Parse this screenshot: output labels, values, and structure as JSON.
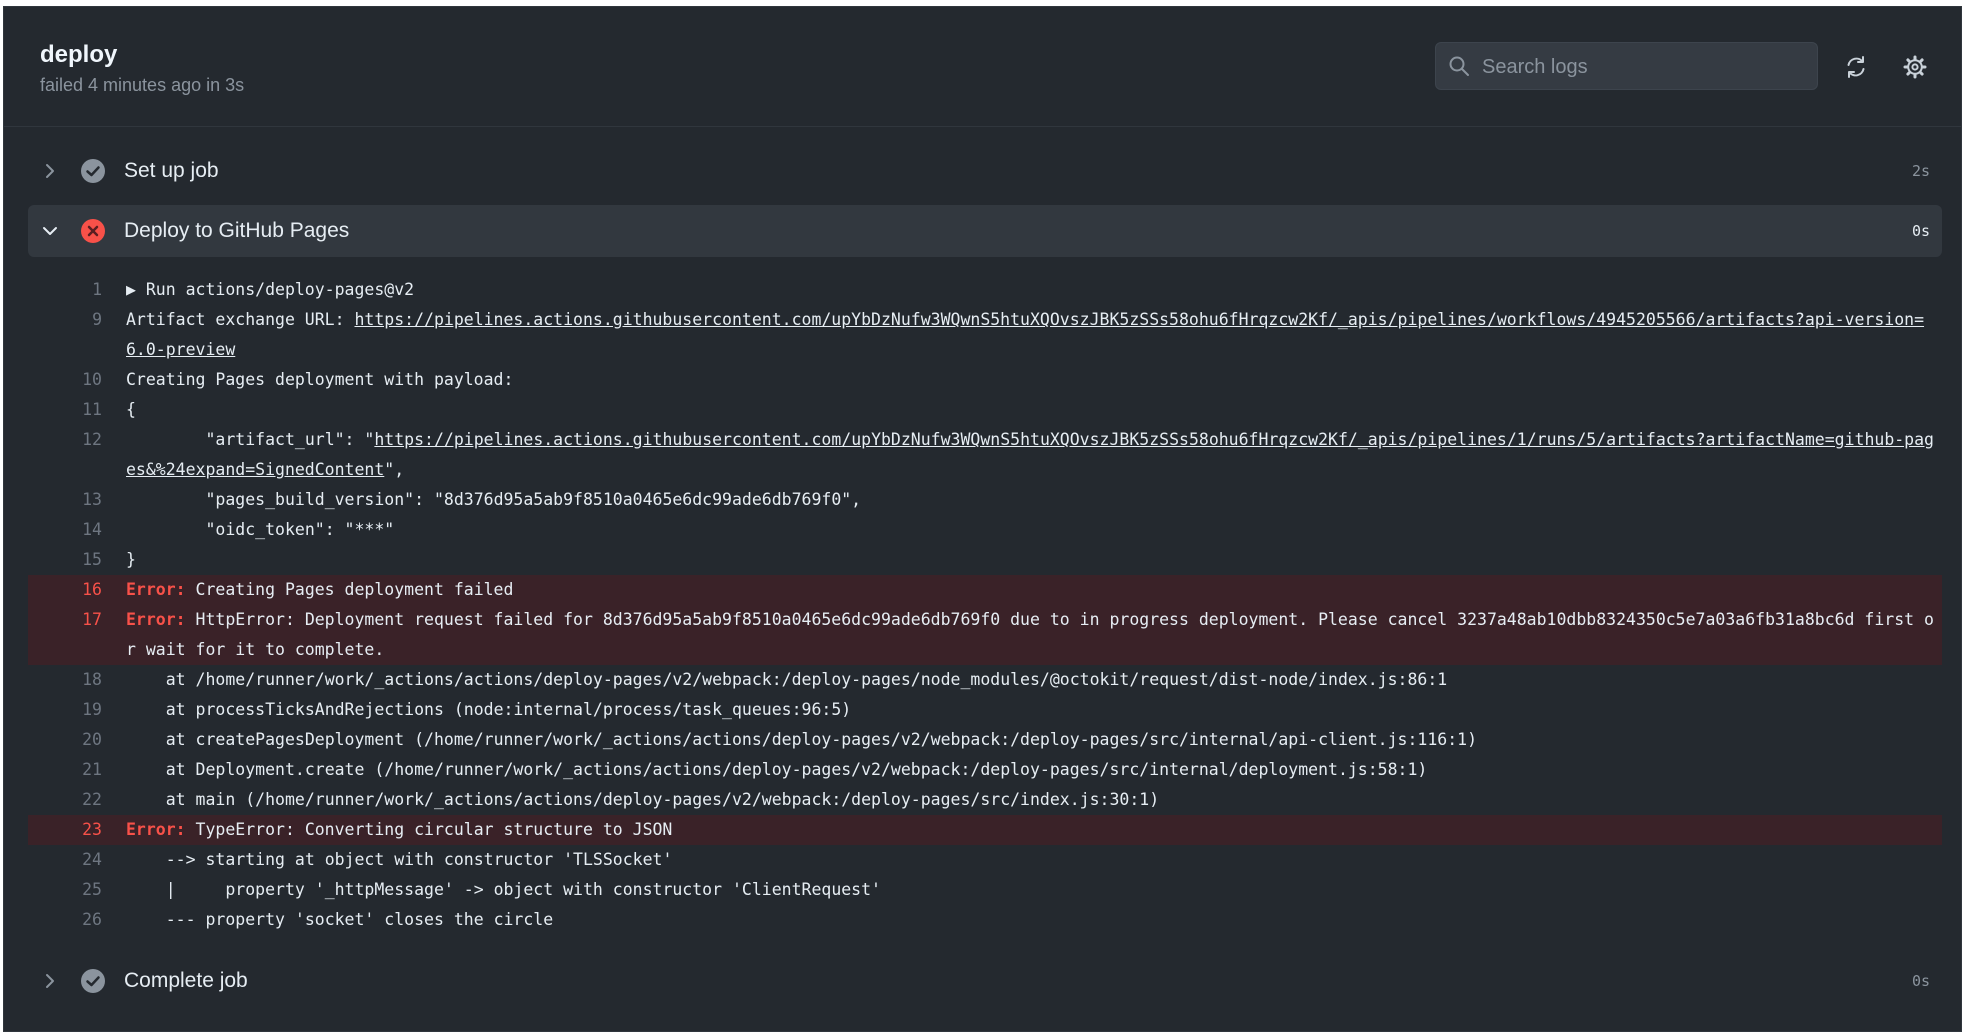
{
  "job": {
    "title": "deploy",
    "subtitle": "failed 4 minutes ago in 3s"
  },
  "search": {
    "placeholder": "Search logs"
  },
  "steps": [
    {
      "name": "Set up job",
      "duration": "2s",
      "status": "success"
    },
    {
      "name": "Deploy to GitHub Pages",
      "duration": "0s",
      "status": "failure"
    },
    {
      "name": "Complete job",
      "duration": "0s",
      "status": "success"
    }
  ],
  "log": {
    "l1": {
      "num": "1",
      "text": "▶ Run actions/deploy-pages@v2"
    },
    "l9": {
      "num": "9",
      "prefix": "Artifact exchange URL: ",
      "link": "https://pipelines.actions.githubusercontent.com/upYbDzNufw3WQwnS5htuXQOvszJBK5zSSs58ohu6fHrqzcw2Kf/_apis/pipelines/workflows/4945205566/artifacts?api-version=6.0-preview"
    },
    "l10": {
      "num": "10",
      "text": "Creating Pages deployment with payload:"
    },
    "l11": {
      "num": "11",
      "text": "{"
    },
    "l12": {
      "num": "12",
      "prefix": "        \"artifact_url\": \"",
      "link": "https://pipelines.actions.githubusercontent.com/upYbDzNufw3WQwnS5htuXQOvszJBK5zSSs58ohu6fHrqzcw2Kf/_apis/pipelines/1/runs/5/artifacts?artifactName=github-pages&%24expand=SignedContent",
      "suffix": "\","
    },
    "l13": {
      "num": "13",
      "text": "        \"pages_build_version\": \"8d376d95a5ab9f8510a0465e6dc99ade6db769f0\","
    },
    "l14": {
      "num": "14",
      "text": "        \"oidc_token\": \"***\""
    },
    "l15": {
      "num": "15",
      "text": "}"
    },
    "l16": {
      "num": "16",
      "label": "Error:",
      "text": " Creating Pages deployment failed"
    },
    "l17": {
      "num": "17",
      "label": "Error:",
      "text": " HttpError: Deployment request failed for 8d376d95a5ab9f8510a0465e6dc99ade6db769f0 due to in progress deployment. Please cancel 3237a48ab10dbb8324350c5e7a03a6fb31a8bc6d first or wait for it to complete."
    },
    "l18": {
      "num": "18",
      "text": "    at /home/runner/work/_actions/actions/deploy-pages/v2/webpack:/deploy-pages/node_modules/@octokit/request/dist-node/index.js:86:1"
    },
    "l19": {
      "num": "19",
      "text": "    at processTicksAndRejections (node:internal/process/task_queues:96:5)"
    },
    "l20": {
      "num": "20",
      "text": "    at createPagesDeployment (/home/runner/work/_actions/actions/deploy-pages/v2/webpack:/deploy-pages/src/internal/api-client.js:116:1)"
    },
    "l21": {
      "num": "21",
      "text": "    at Deployment.create (/home/runner/work/_actions/actions/deploy-pages/v2/webpack:/deploy-pages/src/internal/deployment.js:58:1)"
    },
    "l22": {
      "num": "22",
      "text": "    at main (/home/runner/work/_actions/actions/deploy-pages/v2/webpack:/deploy-pages/src/index.js:30:1)"
    },
    "l23": {
      "num": "23",
      "label": "Error:",
      "text": " TypeError: Converting circular structure to JSON"
    },
    "l24": {
      "num": "24",
      "text": "    --> starting at object with constructor 'TLSSocket'"
    },
    "l25": {
      "num": "25",
      "text": "    |     property '_httpMessage' -> object with constructor 'ClientRequest'"
    },
    "l26": {
      "num": "26",
      "text": "    --- property 'socket' closes the circle"
    }
  },
  "colors": {
    "background": "#24292f",
    "error": "#f85149",
    "success_icon": "#8b949e",
    "error_row": "#3a2228"
  }
}
